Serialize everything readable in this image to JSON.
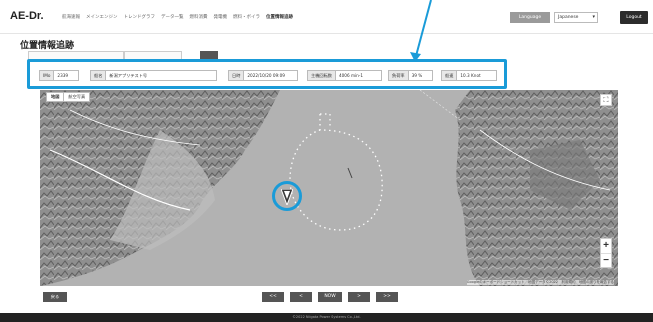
{
  "header": {
    "logo": "AE-Dr.",
    "nav": [
      "航海速報",
      "メインエンジン",
      "トレンドグラフ",
      "データ一覧",
      "燃料消費",
      "発電機",
      "燃料・ボイラ",
      "位置情報追跡"
    ],
    "active_nav": "位置情報追跡",
    "language_label": "Language",
    "language_value": "Japanese",
    "logout_label": "Logout"
  },
  "page_title": "位置情報追跡",
  "info": {
    "imo_label": "IMo",
    "imo_value": "2339",
    "ship_label": "船名",
    "ship_value": "新潟アプリテスト号",
    "datetime_label": "日時",
    "datetime_value": "2022/10/20 09:09",
    "rpm_label": "主機回転数",
    "rpm_value": "4006 min-1",
    "load_label": "負荷率",
    "load_value": "39 %",
    "speed_label": "船速",
    "speed_value": "10.3 Knot"
  },
  "map": {
    "tab_map": "地図",
    "tab_satellite": "航空写真",
    "fullscreen_icon": "fullscreen-icon",
    "zoom_in": "+",
    "zoom_out": "−",
    "attribution": "Googleのキーボードショートカット　地図データ©2022　利用規約　地図の誤りを報告する"
  },
  "controls": {
    "back": "戻る",
    "first": "<<",
    "prev": "<",
    "now": "NOW",
    "next": ">",
    "last": ">>"
  },
  "footer": "©2022 Niigata Power Systems Co.,Ltd.",
  "colors": {
    "highlight": "#1a9bd8",
    "track": "#ffffff",
    "vessel": "#3a3a3a"
  }
}
